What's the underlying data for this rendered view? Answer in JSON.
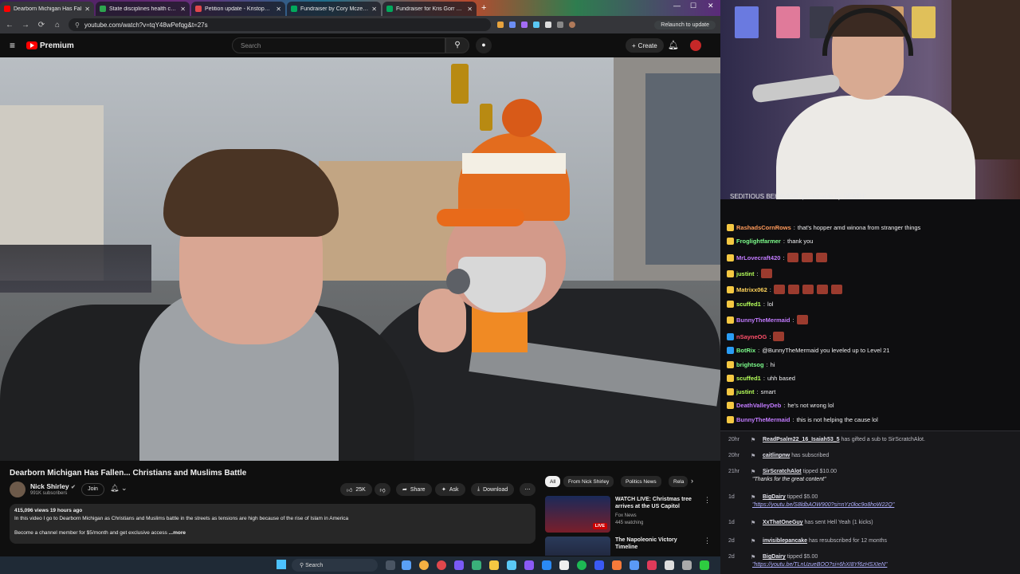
{
  "browser": {
    "tabs": [
      {
        "label": "Dearborn Michigan Has Fal",
        "color": "#ff0000",
        "active": true
      },
      {
        "label": "State disciplines health care pr",
        "color": "#2ea44f",
        "active": false
      },
      {
        "label": "Petition update - Kristopher's",
        "color": "#e0474c",
        "active": false
      },
      {
        "label": "Fundraiser by Cory Mczenna",
        "color": "#02a95c",
        "active": false
      },
      {
        "label": "Fundraiser for Kris Gorr by Kel",
        "color": "#02a95c",
        "active": false
      }
    ],
    "url": "youtube.com/watch?v=tqY48wPefqg&t=27s",
    "relaunch_label": "Relaunch to update"
  },
  "youtube": {
    "brand": "Premium",
    "search_placeholder": "Search",
    "create_label": "Create",
    "video": {
      "title": "Dearborn Michigan Has Fallen... Christians and Muslims Battle",
      "channel": "Nick Shirley",
      "subscribers": "991K subscribers",
      "join_label": "Join",
      "likes": "25K",
      "share_label": "Share",
      "ask_label": "Ask",
      "download_label": "Download",
      "meta": "415,096 views  19 hours ago",
      "description_line1": "In this video I go to Dearborn Michigan as Christians and Muslims battle in the streets as tensions are high because of the rise of Islam in America",
      "description_line2": "Become a channel member for $5/month and get exclusive access",
      "more_label": "...more"
    },
    "chips": [
      "All",
      "From Nick Shirley",
      "Politics News",
      "Rela"
    ],
    "recommendations": [
      {
        "title": "WATCH LIVE: Christmas tree arrives at the US Capitol",
        "channel": "Fox News",
        "meta": "445 watching",
        "badge": "LIVE"
      },
      {
        "title": "The Napoleonic Victory Timeline",
        "channel": "",
        "meta": "",
        "badge": ""
      }
    ]
  },
  "chat": {
    "banner": "SEDITIOUS BEHAVIOR, punishable by DEATH!",
    "messages": [
      {
        "user": "RashadsCornRows",
        "color": "#ff9a5a",
        "text": "that's hopper amd winona from stranger things"
      },
      {
        "user": "Froglightfarmer",
        "color": "#7cfc8a",
        "text": "thank you"
      },
      {
        "user": "MrLovecraft420",
        "color": "#c27bff",
        "text": ""
      },
      {
        "user": "justint",
        "color": "#b6ff5a",
        "text": ""
      },
      {
        "user": "Matrixx062",
        "color": "#ffd35a",
        "text": ""
      },
      {
        "user": "scuffed1",
        "color": "#b6ff5a",
        "text": "lol"
      },
      {
        "user": "BunnyTheMermaid",
        "color": "#c27bff",
        "text": ""
      },
      {
        "user": "nSayneOG",
        "color": "#ff4f6a",
        "text": ""
      },
      {
        "user": "BotRix",
        "color": "#7cfc8a",
        "text": "@BunnyTheMermaid you leveled up to Level 21"
      },
      {
        "user": "brightsog",
        "color": "#7cfc8a",
        "text": "hi"
      },
      {
        "user": "scuffed1",
        "color": "#b6ff5a",
        "text": "uhh based"
      },
      {
        "user": "justint",
        "color": "#b6ff5a",
        "text": "smart"
      },
      {
        "user": "DeathValleyDeb",
        "color": "#c27bff",
        "text": "he's not wrong lol"
      },
      {
        "user": "BunnyTheMermaid",
        "color": "#c27bff",
        "text": "this is not helping the cause lol"
      }
    ]
  },
  "activity": [
    {
      "age": "20hr",
      "user": "ReadPsalm22_16_Isaiah53_5",
      "text": "has gifted a sub to SirScratchAlot.",
      "sub": ""
    },
    {
      "age": "20hr",
      "user": "caitlinpnw",
      "text": "has subscribed",
      "sub": ""
    },
    {
      "age": "21hr",
      "user": "SirScratchAlot",
      "text": "tipped $10.00",
      "sub": "\"Thanks for the great content\""
    },
    {
      "age": "1d",
      "user": "BigDairy",
      "text": "tipped $5.00",
      "sub": "\"https://youtu.be/S8ldbAOW900?si=nYz0loc9o8hoW22Q\""
    },
    {
      "age": "1d",
      "user": "XxThatOneGuy",
      "text": "has sent Hell Yeah (1 kicks)",
      "sub": ""
    },
    {
      "age": "2d",
      "user": "invisiblepancake",
      "text": "has resubscribed for 12 months",
      "sub": ""
    },
    {
      "age": "2d",
      "user": "BigDairy",
      "text": "tipped $5.00",
      "sub": "\"https://youtu.be/TLnUzueBOO?si=6hXI8Yf6zHSXIeN\""
    }
  ],
  "taskbar": {
    "search_placeholder": "Search"
  }
}
